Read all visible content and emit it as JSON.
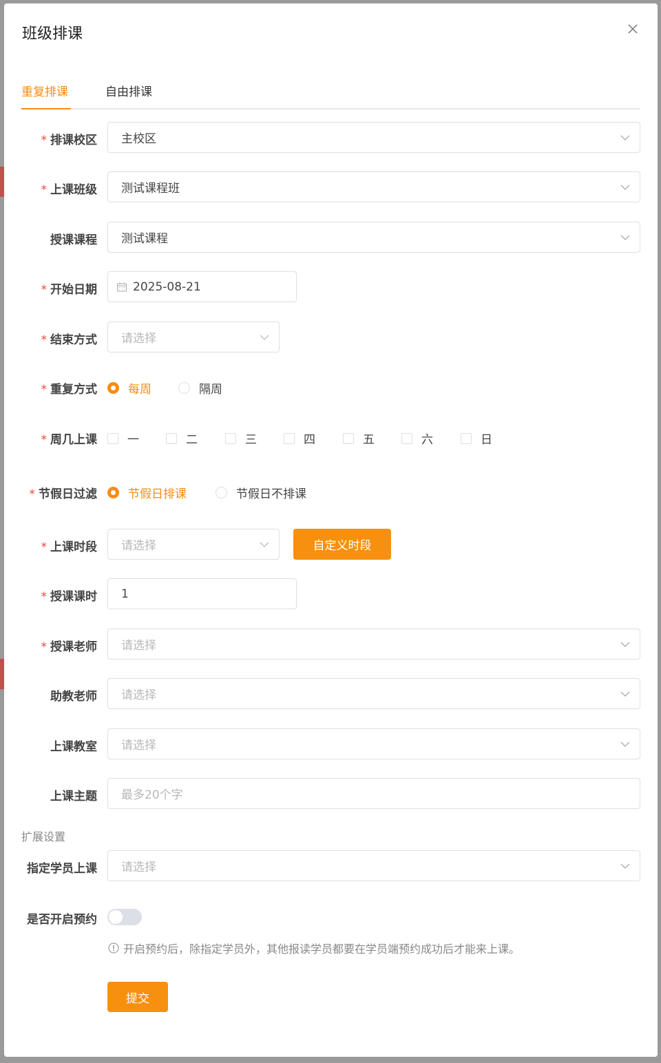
{
  "modal": {
    "title": "班级排课"
  },
  "tabs": [
    {
      "label": "重复排课",
      "active": true
    },
    {
      "label": "自由排课",
      "active": false
    }
  ],
  "form": {
    "campus": {
      "label": "排课校区",
      "value": "主校区"
    },
    "class": {
      "label": "上课班级",
      "value": "测试课程班"
    },
    "course": {
      "label": "授课课程",
      "value": "测试课程"
    },
    "start_date": {
      "label": "开始日期",
      "value": "2025-08-21"
    },
    "end_mode": {
      "label": "结束方式",
      "placeholder": "请选择"
    },
    "repeat": {
      "label": "重复方式",
      "options": [
        "每周",
        "隔周"
      ],
      "selected": "每周"
    },
    "weekdays": {
      "label": "周几上课",
      "options": [
        "一",
        "二",
        "三",
        "四",
        "五",
        "六",
        "日"
      ]
    },
    "holiday": {
      "label": "节假日过滤",
      "options": [
        "节假日排课",
        "节假日不排课"
      ],
      "selected": "节假日排课"
    },
    "time_slot": {
      "label": "上课时段",
      "placeholder": "请选择",
      "custom_button": "自定义时段"
    },
    "hours": {
      "label": "授课课时",
      "value": "1"
    },
    "teacher": {
      "label": "授课老师",
      "placeholder": "请选择"
    },
    "assistant": {
      "label": "助教老师",
      "placeholder": "请选择"
    },
    "classroom": {
      "label": "上课教室",
      "placeholder": "请选择"
    },
    "topic": {
      "label": "上课主题",
      "placeholder": "最多20个字"
    }
  },
  "extended": {
    "section_title": "扩展设置",
    "students": {
      "label": "指定学员上课",
      "placeholder": "请选择"
    },
    "booking": {
      "label": "是否开启预约",
      "enabled": false,
      "hint": "开启预约后，除指定学员外，其他报读学员都要在学员端预约成功后才能来上课。"
    }
  },
  "submit_label": "提交",
  "required_mark": "*",
  "colors": {
    "accent": "#f88c12",
    "required": "#e9483c"
  }
}
